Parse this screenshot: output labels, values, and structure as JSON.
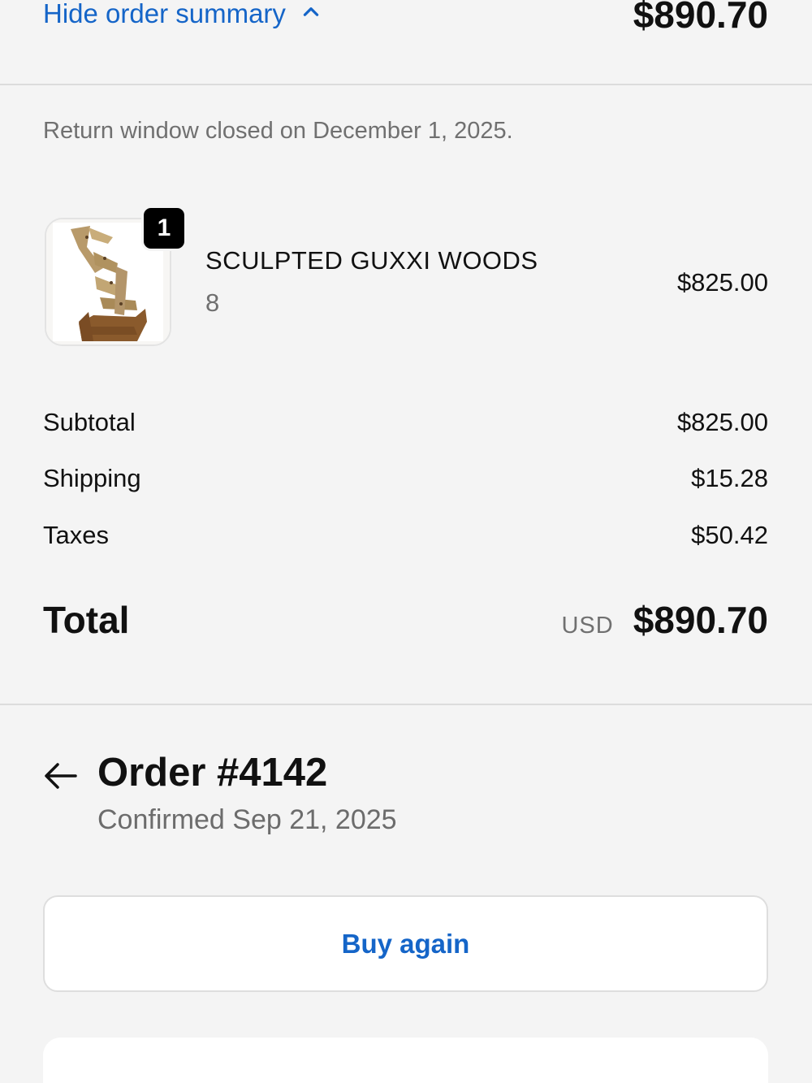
{
  "summary": {
    "toggle_label": "Hide order summary",
    "total": "$890.70",
    "return_note": "Return window closed on December 1, 2025."
  },
  "item": {
    "quantity": "1",
    "name": "SCULPTED GUXXI WOODS",
    "variant": "8",
    "price": "$825.00",
    "image_icon": "shoe-product-photo"
  },
  "costs": {
    "subtotal_label": "Subtotal",
    "subtotal_value": "$825.00",
    "shipping_label": "Shipping",
    "shipping_value": "$15.28",
    "taxes_label": "Taxes",
    "taxes_value": "$50.42",
    "total_label": "Total",
    "currency": "USD",
    "total_value": "$890.70"
  },
  "order": {
    "title": "Order #4142",
    "confirmed": "Confirmed Sep 21, 2025"
  },
  "actions": {
    "buy_again": "Buy again"
  },
  "colors": {
    "accent": "#1565c8",
    "background": "#f4f4f4"
  }
}
